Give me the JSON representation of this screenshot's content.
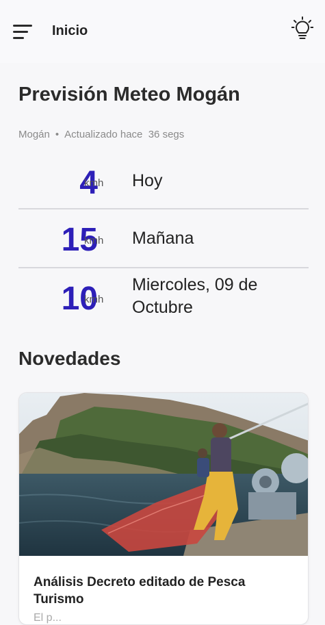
{
  "appbar": {
    "title": "Inicio",
    "menu_icon": "hamburger-menu-icon",
    "action_icon": "lightbulb-icon"
  },
  "page": {
    "title": "Previsión Meteo Mogán",
    "location": "Mogán",
    "separator": "•",
    "updated": "Actualizado hace  36 segs"
  },
  "forecast": [
    {
      "value": "4",
      "unit": "kmh",
      "day": "Hoy"
    },
    {
      "value": "15",
      "unit": "kmh",
      "day": "Mañana"
    },
    {
      "value": "10",
      "unit": "kmh",
      "day": "Miercoles, 09 de Octubre"
    }
  ],
  "news": {
    "section_title": "Novedades",
    "items": [
      {
        "title": "Análisis Decreto editado de Pesca Turismo",
        "excerpt": "El p..."
      }
    ]
  },
  "colors": {
    "accent_value": "#2d1fb8",
    "background": "#f7f7f9"
  }
}
